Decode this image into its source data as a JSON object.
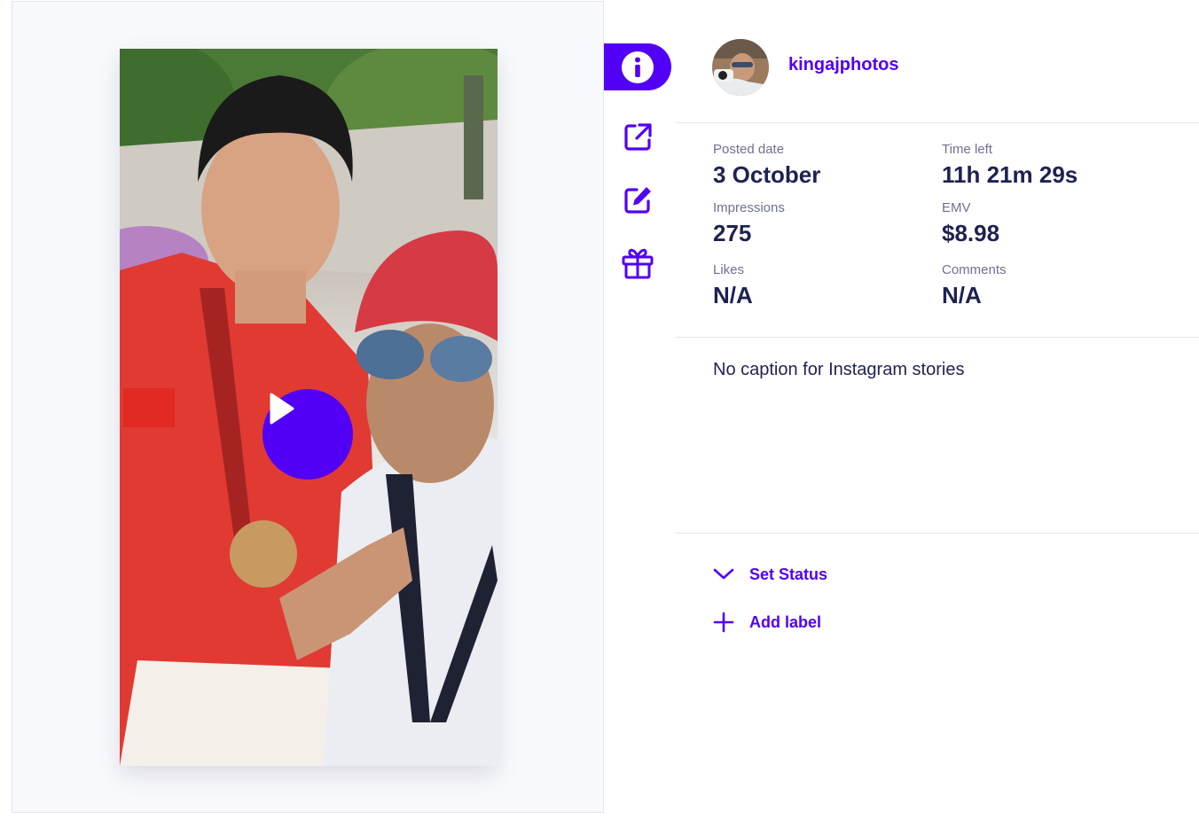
{
  "profile": {
    "username": "kingajphotos",
    "avatar_alt": "profile photo"
  },
  "metrics": [
    {
      "label": "Posted date",
      "value": "3 October"
    },
    {
      "label": "Time left",
      "value": "11h 21m 29s"
    },
    {
      "label": "Impressions",
      "value": "275"
    },
    {
      "label": "EMV",
      "value": "$8.98"
    },
    {
      "label": "Likes",
      "value": "N/A"
    },
    {
      "label": "Comments",
      "value": "N/A"
    }
  ],
  "caption": "No caption for Instagram stories",
  "actions": {
    "set_status": "Set Status",
    "add_label": "Add label"
  },
  "rail_icons": [
    "info-icon",
    "external-link-icon",
    "edit-icon",
    "gift-icon"
  ],
  "colors": {
    "accent": "#5200f5",
    "text": "#1e2251",
    "muted": "#6e7191"
  }
}
